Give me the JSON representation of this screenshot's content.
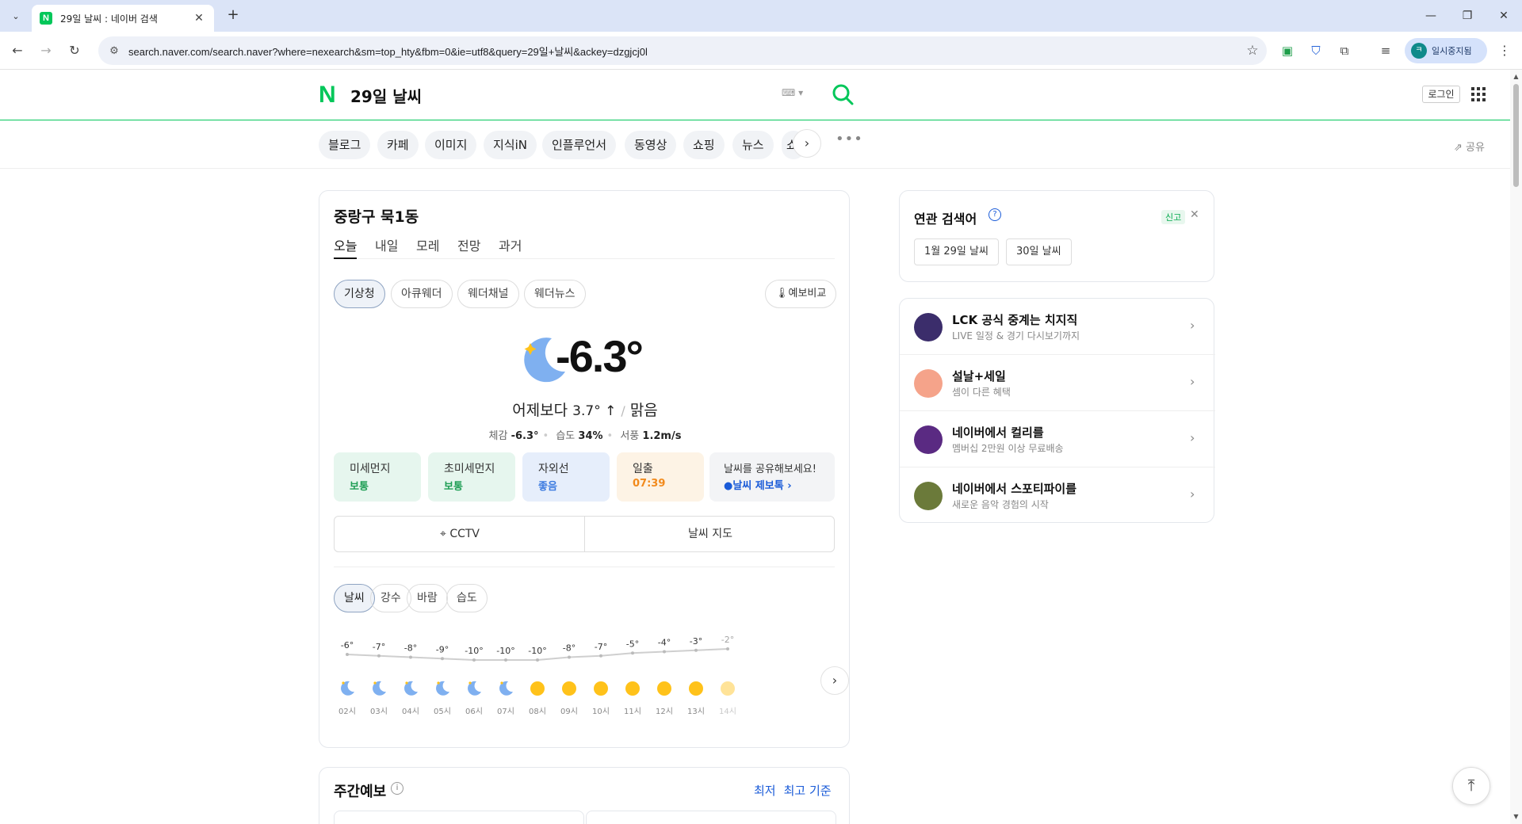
{
  "browser": {
    "tab_title": "29일 날씨 : 네이버 검색",
    "favicon_letter": "N",
    "url": "search.naver.com/search.naver?where=nexearch&sm=top_hty&fbm=0&ie=utf8&query=29일+날씨&ackey=dzgjcj0l",
    "profile_initial": "ㅋ",
    "profile_label": "일시중지됨"
  },
  "header": {
    "logo": "N",
    "query": "29일 날씨",
    "login_label": "로그인"
  },
  "categories": [
    "블로그",
    "카페",
    "이미지",
    "지식iN",
    "인플루언서",
    "동영상",
    "쇼핑",
    "뉴스",
    "쇼"
  ],
  "share_label": "공유",
  "weather": {
    "location": "중랑구 묵1동",
    "day_tabs": [
      "오늘",
      "내일",
      "모레",
      "전망",
      "과거"
    ],
    "providers": [
      "기상청",
      "아큐웨더",
      "웨더채널",
      "웨더뉴스"
    ],
    "compare_label": "예보비교",
    "current_temp": "-6.3°",
    "compare_prefix": "어제보다",
    "compare_diff": "3.7° ↑",
    "condition": "맑음",
    "details": [
      {
        "label": "체감",
        "value": "-6.3°"
      },
      {
        "label": "습도",
        "value": "34%"
      },
      {
        "label": "서풍",
        "value": "1.2m/s"
      }
    ],
    "quick": [
      {
        "label": "미세먼지",
        "value": "보통",
        "bg": "#e6f6ee",
        "color": "#1f9e55"
      },
      {
        "label": "초미세먼지",
        "value": "보통",
        "bg": "#e6f6ee",
        "color": "#1f9e55"
      },
      {
        "label": "자외선",
        "value": "좋음",
        "bg": "#e6eefb",
        "color": "#3c7be0"
      },
      {
        "label": "일출",
        "value": "07:39",
        "bg": "#fdf3e5",
        "color": "#f28a1c"
      }
    ],
    "share_prompt": "날씨를 공유해보세요!",
    "report_label": "날씨 제보톡 ›",
    "cctv_label": "CCTV",
    "map_label": "날씨 지도",
    "metric_tabs": [
      "날씨",
      "강수",
      "바람",
      "습도"
    ],
    "hourly": [
      {
        "hour": "02시",
        "temp": -6,
        "label": "-6°",
        "icon": "moon"
      },
      {
        "hour": "03시",
        "temp": -7,
        "label": "-7°",
        "icon": "moon"
      },
      {
        "hour": "04시",
        "temp": -8,
        "label": "-8°",
        "icon": "moon"
      },
      {
        "hour": "05시",
        "temp": -9,
        "label": "-9°",
        "icon": "moon"
      },
      {
        "hour": "06시",
        "temp": -10,
        "label": "-10°",
        "icon": "moon"
      },
      {
        "hour": "07시",
        "temp": -10,
        "label": "-10°",
        "icon": "moon"
      },
      {
        "hour": "08시",
        "temp": -10,
        "label": "-10°",
        "icon": "sun"
      },
      {
        "hour": "09시",
        "temp": -8,
        "label": "-8°",
        "icon": "sun"
      },
      {
        "hour": "10시",
        "temp": -7,
        "label": "-7°",
        "icon": "sun"
      },
      {
        "hour": "11시",
        "temp": -5,
        "label": "-5°",
        "icon": "sun"
      },
      {
        "hour": "12시",
        "temp": -4,
        "label": "-4°",
        "icon": "sun"
      },
      {
        "hour": "13시",
        "temp": -3,
        "label": "-3°",
        "icon": "sun"
      },
      {
        "hour": "14시",
        "temp": -2,
        "label": "-2°",
        "icon": "sun"
      }
    ],
    "weekly_title": "주간예보",
    "weekly_sort": [
      "최저",
      "최고 기준"
    ]
  },
  "related": {
    "title": "연관 검색어",
    "report_label": "신고",
    "keywords": [
      "1월 29일 날씨",
      "30일 날씨"
    ]
  },
  "promos": [
    {
      "title": "LCK 공식 중계는 치지직",
      "sub": "LIVE 일정 & 경기 다시보기까지",
      "color": "#3b2d6b"
    },
    {
      "title": "설날+세일",
      "sub": "셈이 다른 혜택",
      "color": "#f5a38a"
    },
    {
      "title": "네이버에서 컬리를",
      "sub": "멤버십 2만원 이상 무료배송",
      "color": "#5a2a82"
    },
    {
      "title": "네이버에서 스포티파이를",
      "sub": "새로운 음악 경험의 시작",
      "color": "#6b7a3a"
    }
  ],
  "colors": {
    "naver_green": "#03c75a",
    "link_blue": "#1a5bd8",
    "sun": "#ffc21a",
    "moon": "#7fb0f0"
  }
}
